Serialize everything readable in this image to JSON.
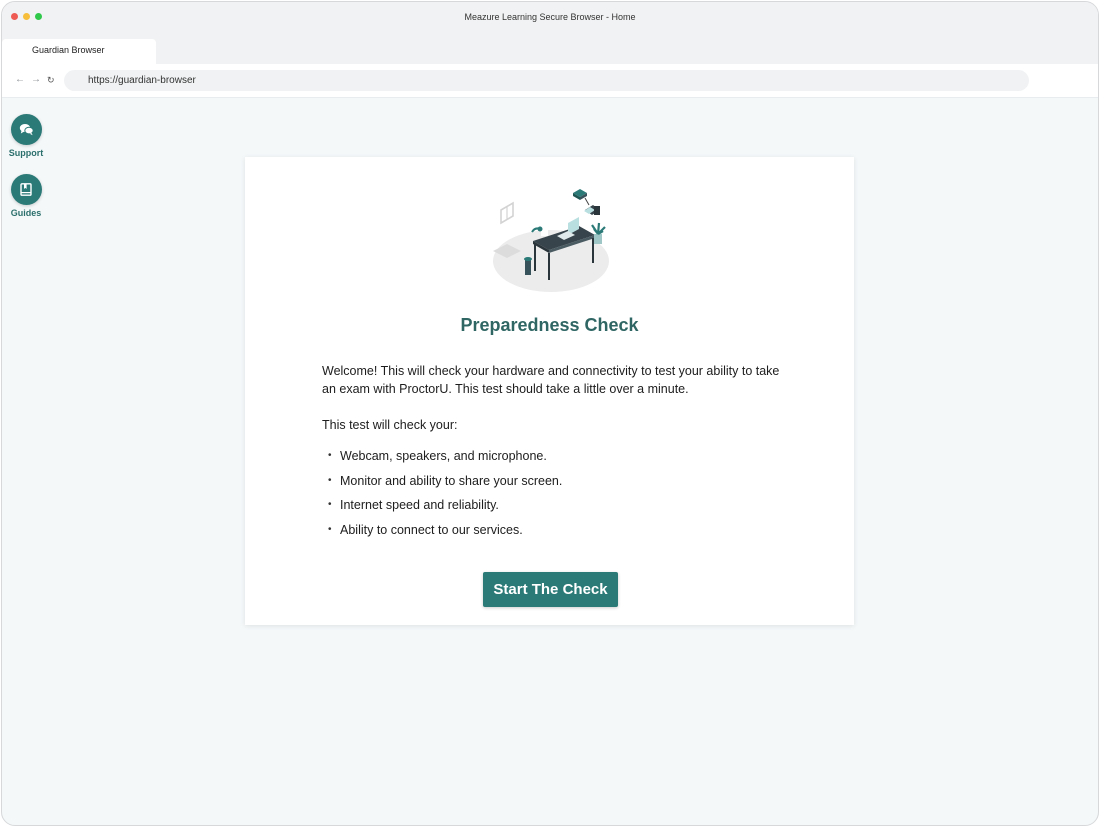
{
  "window": {
    "title": "Meazure Learning Secure Browser - Home",
    "tab_label": "Guardian Browser",
    "url": "https://guardian-browser"
  },
  "toolbar": {
    "back_icon": "arrow-left-icon",
    "forward_icon": "arrow-right-icon",
    "reload_icon": "reload-icon"
  },
  "sidebar": {
    "items": [
      {
        "label": "Support",
        "icon": "chat-bubbles-icon"
      },
      {
        "label": "Guides",
        "icon": "book-icon"
      }
    ]
  },
  "card": {
    "title": "Preparedness Check",
    "intro": "Welcome! This will check your hardware and connectivity to test your ability to take an exam with ProctorU. This test should take a little over a minute.",
    "check_heading": "This test will check your:",
    "check_items": [
      "Webcam, speakers, and microphone.",
      "Monitor and ability to share your screen.",
      "Internet speed and reliability.",
      "Ability to connect to our services."
    ],
    "start_label": "Start The Check"
  },
  "colors": {
    "accent": "#2b7a78",
    "title_text": "#2f6664",
    "page_bg": "#f4f8f9"
  }
}
